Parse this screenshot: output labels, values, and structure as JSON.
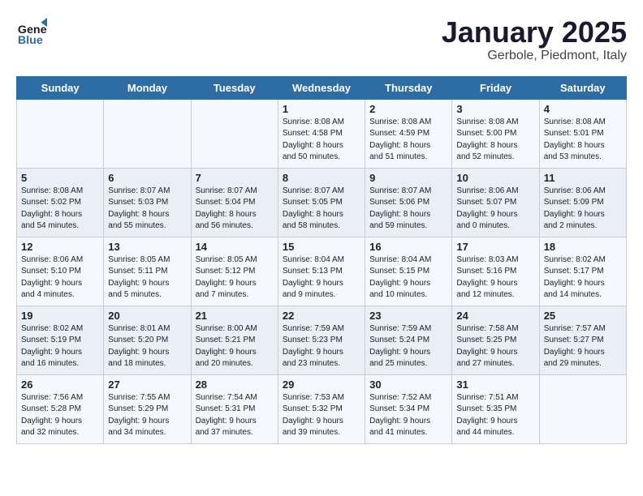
{
  "logo": {
    "line1": "General",
    "line2": "Blue"
  },
  "title": "January 2025",
  "subtitle": "Gerbole, Piedmont, Italy",
  "days_of_week": [
    "Sunday",
    "Monday",
    "Tuesday",
    "Wednesday",
    "Thursday",
    "Friday",
    "Saturday"
  ],
  "weeks": [
    [
      {
        "num": "",
        "info": ""
      },
      {
        "num": "",
        "info": ""
      },
      {
        "num": "",
        "info": ""
      },
      {
        "num": "1",
        "info": "Sunrise: 8:08 AM\nSunset: 4:58 PM\nDaylight: 8 hours\nand 50 minutes."
      },
      {
        "num": "2",
        "info": "Sunrise: 8:08 AM\nSunset: 4:59 PM\nDaylight: 8 hours\nand 51 minutes."
      },
      {
        "num": "3",
        "info": "Sunrise: 8:08 AM\nSunset: 5:00 PM\nDaylight: 8 hours\nand 52 minutes."
      },
      {
        "num": "4",
        "info": "Sunrise: 8:08 AM\nSunset: 5:01 PM\nDaylight: 8 hours\nand 53 minutes."
      }
    ],
    [
      {
        "num": "5",
        "info": "Sunrise: 8:08 AM\nSunset: 5:02 PM\nDaylight: 8 hours\nand 54 minutes."
      },
      {
        "num": "6",
        "info": "Sunrise: 8:07 AM\nSunset: 5:03 PM\nDaylight: 8 hours\nand 55 minutes."
      },
      {
        "num": "7",
        "info": "Sunrise: 8:07 AM\nSunset: 5:04 PM\nDaylight: 8 hours\nand 56 minutes."
      },
      {
        "num": "8",
        "info": "Sunrise: 8:07 AM\nSunset: 5:05 PM\nDaylight: 8 hours\nand 58 minutes."
      },
      {
        "num": "9",
        "info": "Sunrise: 8:07 AM\nSunset: 5:06 PM\nDaylight: 8 hours\nand 59 minutes."
      },
      {
        "num": "10",
        "info": "Sunrise: 8:06 AM\nSunset: 5:07 PM\nDaylight: 9 hours\nand 0 minutes."
      },
      {
        "num": "11",
        "info": "Sunrise: 8:06 AM\nSunset: 5:09 PM\nDaylight: 9 hours\nand 2 minutes."
      }
    ],
    [
      {
        "num": "12",
        "info": "Sunrise: 8:06 AM\nSunset: 5:10 PM\nDaylight: 9 hours\nand 4 minutes."
      },
      {
        "num": "13",
        "info": "Sunrise: 8:05 AM\nSunset: 5:11 PM\nDaylight: 9 hours\nand 5 minutes."
      },
      {
        "num": "14",
        "info": "Sunrise: 8:05 AM\nSunset: 5:12 PM\nDaylight: 9 hours\nand 7 minutes."
      },
      {
        "num": "15",
        "info": "Sunrise: 8:04 AM\nSunset: 5:13 PM\nDaylight: 9 hours\nand 9 minutes."
      },
      {
        "num": "16",
        "info": "Sunrise: 8:04 AM\nSunset: 5:15 PM\nDaylight: 9 hours\nand 10 minutes."
      },
      {
        "num": "17",
        "info": "Sunrise: 8:03 AM\nSunset: 5:16 PM\nDaylight: 9 hours\nand 12 minutes."
      },
      {
        "num": "18",
        "info": "Sunrise: 8:02 AM\nSunset: 5:17 PM\nDaylight: 9 hours\nand 14 minutes."
      }
    ],
    [
      {
        "num": "19",
        "info": "Sunrise: 8:02 AM\nSunset: 5:19 PM\nDaylight: 9 hours\nand 16 minutes."
      },
      {
        "num": "20",
        "info": "Sunrise: 8:01 AM\nSunset: 5:20 PM\nDaylight: 9 hours\nand 18 minutes."
      },
      {
        "num": "21",
        "info": "Sunrise: 8:00 AM\nSunset: 5:21 PM\nDaylight: 9 hours\nand 20 minutes."
      },
      {
        "num": "22",
        "info": "Sunrise: 7:59 AM\nSunset: 5:23 PM\nDaylight: 9 hours\nand 23 minutes."
      },
      {
        "num": "23",
        "info": "Sunrise: 7:59 AM\nSunset: 5:24 PM\nDaylight: 9 hours\nand 25 minutes."
      },
      {
        "num": "24",
        "info": "Sunrise: 7:58 AM\nSunset: 5:25 PM\nDaylight: 9 hours\nand 27 minutes."
      },
      {
        "num": "25",
        "info": "Sunrise: 7:57 AM\nSunset: 5:27 PM\nDaylight: 9 hours\nand 29 minutes."
      }
    ],
    [
      {
        "num": "26",
        "info": "Sunrise: 7:56 AM\nSunset: 5:28 PM\nDaylight: 9 hours\nand 32 minutes."
      },
      {
        "num": "27",
        "info": "Sunrise: 7:55 AM\nSunset: 5:29 PM\nDaylight: 9 hours\nand 34 minutes."
      },
      {
        "num": "28",
        "info": "Sunrise: 7:54 AM\nSunset: 5:31 PM\nDaylight: 9 hours\nand 37 minutes."
      },
      {
        "num": "29",
        "info": "Sunrise: 7:53 AM\nSunset: 5:32 PM\nDaylight: 9 hours\nand 39 minutes."
      },
      {
        "num": "30",
        "info": "Sunrise: 7:52 AM\nSunset: 5:34 PM\nDaylight: 9 hours\nand 41 minutes."
      },
      {
        "num": "31",
        "info": "Sunrise: 7:51 AM\nSunset: 5:35 PM\nDaylight: 9 hours\nand 44 minutes."
      },
      {
        "num": "",
        "info": ""
      }
    ]
  ]
}
